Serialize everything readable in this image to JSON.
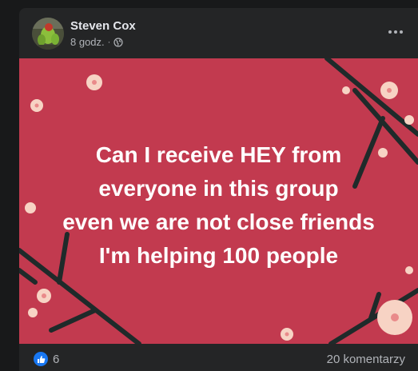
{
  "post": {
    "author": "Steven Cox",
    "time": "8 godz.",
    "separator": "·",
    "privacy_icon": "globe-icon",
    "more_icon": "ellipsis-icon",
    "background_color": "#c23a4f",
    "text_lines": [
      "Can I receive HEY from",
      "everyone in this group",
      "even we are not close friends",
      "I'm helping 100 people"
    ]
  },
  "reactions": {
    "icon": "thumbs-up-icon",
    "count": "6",
    "color": "#1877f2"
  },
  "comments": {
    "label": "20 komentarzy"
  }
}
